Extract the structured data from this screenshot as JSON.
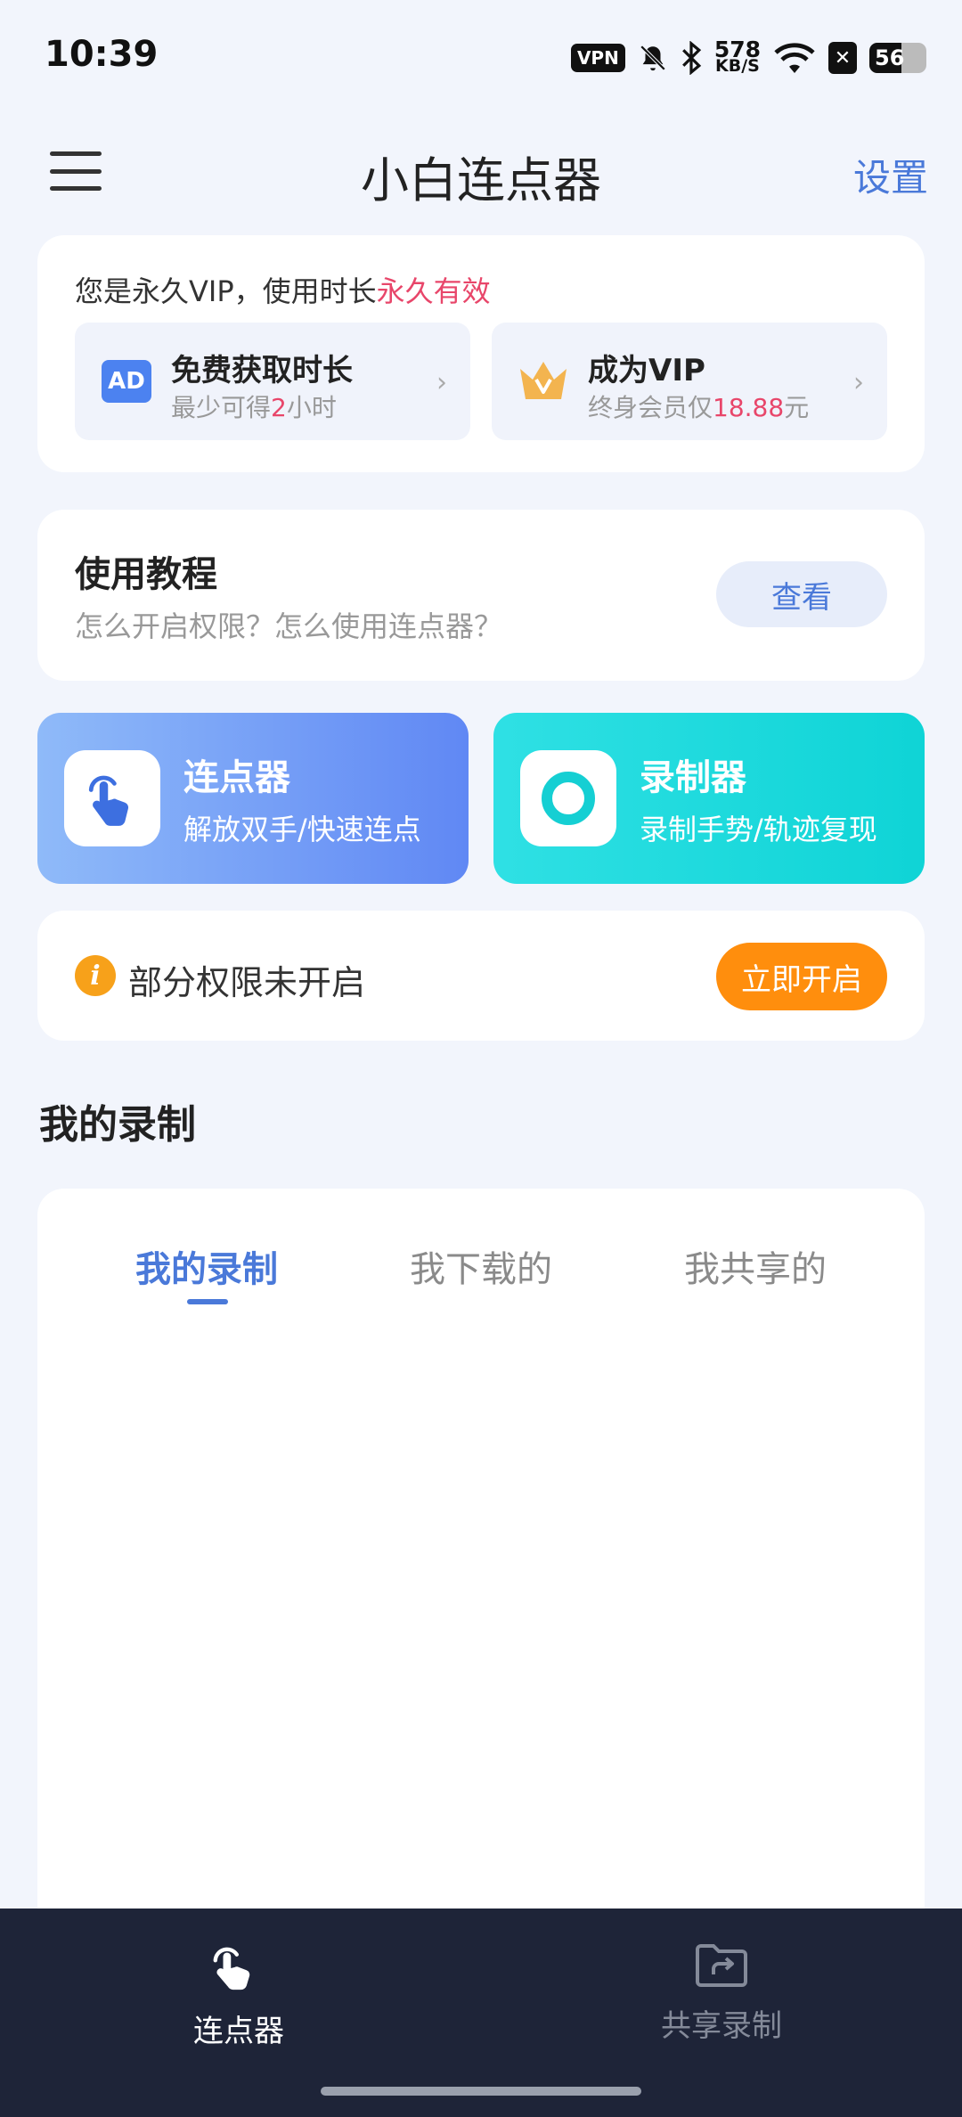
{
  "status_bar": {
    "time": "10:39",
    "vpn": "VPN",
    "speed_value": "578",
    "speed_unit": "KB/S",
    "battery_level": "56",
    "battery_fraction": 0.56
  },
  "header": {
    "title": "小白连点器",
    "settings_label": "设置"
  },
  "vip": {
    "status_prefix": "您是永久VIP，使用时长",
    "status_value": "永久有效",
    "free_time": {
      "icon_text": "AD",
      "title": "免费获取时长",
      "sub_prefix": "最少可得",
      "sub_value": "2",
      "sub_suffix": "小时"
    },
    "become_vip": {
      "title": "成为VIP",
      "sub_prefix": "终身会员仅",
      "sub_value": "18.88",
      "sub_suffix": "元"
    }
  },
  "tutorial": {
    "title": "使用教程",
    "subtitle": "怎么开启权限？怎么使用连点器？",
    "button": "查看"
  },
  "features": {
    "clicker": {
      "title": "连点器",
      "subtitle": "解放双手/快速连点"
    },
    "recorder": {
      "title": "录制器",
      "subtitle": "录制手势/轨迹复现"
    }
  },
  "permission": {
    "icon_text": "i",
    "message": "部分权限未开启",
    "button": "立即开启"
  },
  "recordings": {
    "section_title": "我的录制",
    "tabs": [
      "我的录制",
      "我下载的",
      "我共享的"
    ],
    "active_tab": 0
  },
  "bottom_nav": {
    "items": [
      {
        "label": "连点器",
        "icon": "tap-hand-icon",
        "active": true
      },
      {
        "label": "共享录制",
        "icon": "share-folder-icon",
        "active": false
      }
    ]
  },
  "colors": {
    "accent": "#4a79d9",
    "price_red": "#e8466a",
    "orange": "#ff8e0d",
    "nav_bg": "#1e2438"
  }
}
